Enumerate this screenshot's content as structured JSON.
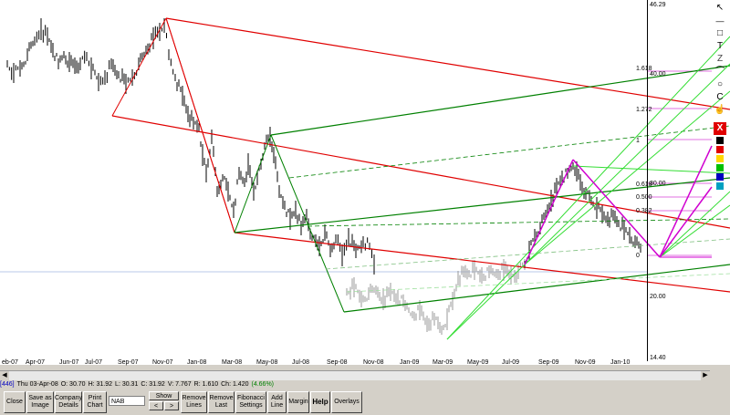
{
  "y_axis": {
    "ticks": [
      "46.29",
      "40.00",
      "30.00",
      "20.00",
      "14.40"
    ]
  },
  "x_axis": {
    "ticks": [
      "eb-07",
      "Apr-07",
      "Jun-07",
      "Jul-07",
      "Sep-07",
      "Nov-07",
      "Jan-08",
      "Mar-08",
      "May-08",
      "Jul-08",
      "Sep-08",
      "Nov-08",
      "Jan-09",
      "Mar-09",
      "May-09",
      "Jul-09",
      "Sep-09",
      "Nov-09",
      "Jan-10"
    ]
  },
  "fib_levels": [
    "1.618",
    "1.272",
    "1",
    "0.618",
    "0.500",
    "0.382",
    "0"
  ],
  "status": {
    "id": "[446]",
    "date": "Thu 03-Apr-08",
    "open": "O: 30.70",
    "high": "H: 31.92",
    "low": "L: 30.31",
    "close": "C: 31.92",
    "volume": "V: 7.767",
    "range": "R: 1.610",
    "change": "Ch: 1.420",
    "change_pct": "(4.66%)"
  },
  "toolbar": {
    "close": "Close",
    "save_as_image": "Save as Image",
    "company_details": "Company Details",
    "print_chart": "Print Chart",
    "code_value": "NAB",
    "show": "Show",
    "prev": "<",
    "next": ">",
    "remove_lines": "Remove Lines",
    "remove_last": "Remove Last",
    "fibonacci_settings": "Fibonacci Settings",
    "add_line": "Add Line",
    "margin": "Margin",
    "help": "Help",
    "overlays": "Overlays"
  },
  "colors": {
    "red_pitchfork": "#e00000",
    "dark_green_pitchfork": "#008000",
    "light_green_pitchfork": "#33dd33",
    "magenta": "#d000d0",
    "price": "#000000",
    "price_faded": "#999999"
  }
}
